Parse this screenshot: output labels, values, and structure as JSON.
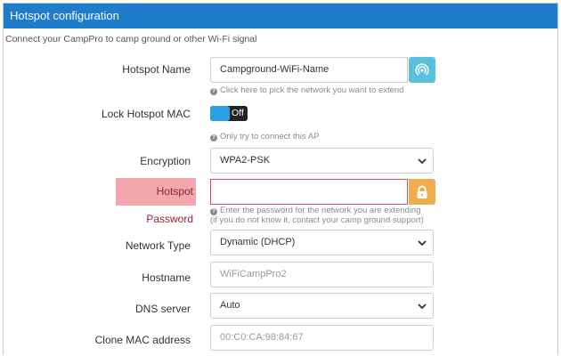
{
  "panel": {
    "title": "Hotspot configuration",
    "description": "Connect your CampPro to camp ground or other Wi-Fi signal"
  },
  "hotspot_name": {
    "label": "Hotspot Name",
    "value": "Campground-WiFi-Name",
    "help": "Click here to pick the network you want to extend",
    "icon": "wifi-scan-icon"
  },
  "lock_mac": {
    "label": "Lock Hotspot MAC",
    "toggle_text": "Off",
    "help": "Only try to connect this AP"
  },
  "encryption": {
    "label": "Encryption",
    "value": "WPA2-PSK"
  },
  "password": {
    "label": "Hotspot Password",
    "value": "",
    "help_line1": "Enter the password for the network you are extending",
    "help_line2": "(if you do not know it, contact your camp ground support)",
    "icon": "lock-icon"
  },
  "network_type": {
    "label": "Network Type",
    "value": "Dynamic (DHCP)"
  },
  "hostname": {
    "label": "Hostname",
    "value": "WiFiCampPro2"
  },
  "dns": {
    "label": "DNS server",
    "value": "Auto"
  },
  "clone_mac": {
    "label": "Clone MAC address",
    "value": "00:C0:CA:98:84:67"
  },
  "colors": {
    "header": "#1d7ccb",
    "wifi_button": "#5bc0de",
    "lock_button": "#f0ad4e",
    "error_label_bg": "#f3a6ab",
    "error_border": "#d94b55",
    "toggle_knob": "#2b9fe3"
  }
}
